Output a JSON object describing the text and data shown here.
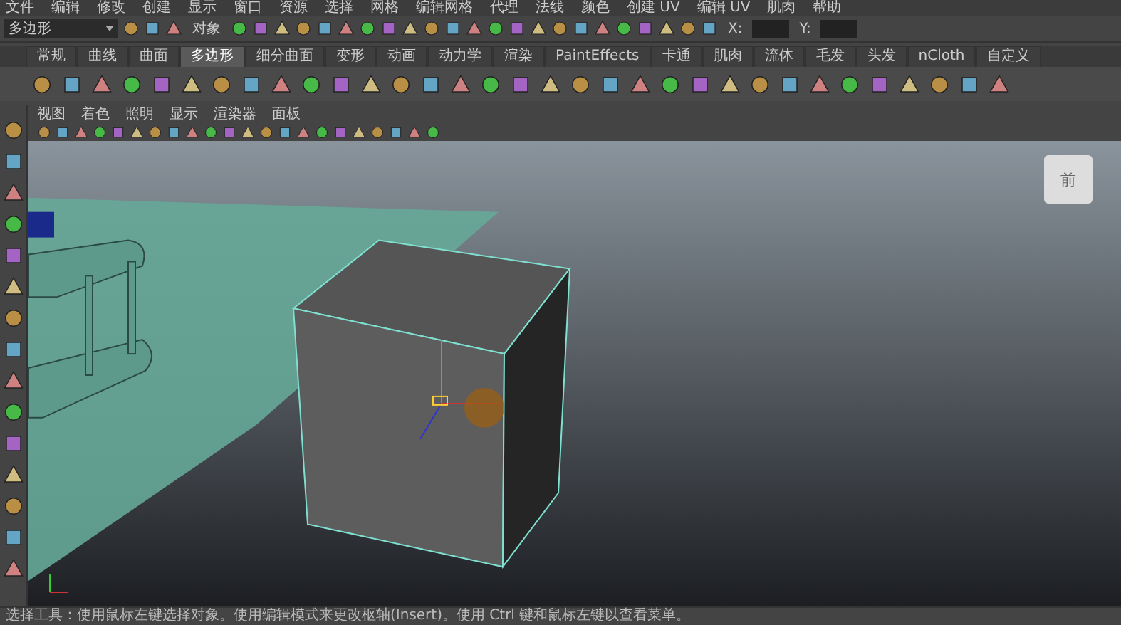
{
  "menu_bar": [
    "文件",
    "编辑",
    "修改",
    "创建",
    "显示",
    "窗口",
    "资源",
    "选择",
    "网格",
    "编辑网格",
    "代理",
    "法线",
    "颜色",
    "创建 UV",
    "编辑 UV",
    "肌肉",
    "帮助"
  ],
  "status_line": {
    "mode_menu": "多边形",
    "selection_label": "对象",
    "x_label": "X:",
    "y_label": "Y:"
  },
  "shelf": {
    "tabs": [
      {
        "label": "常规",
        "selected": false
      },
      {
        "label": "曲线",
        "selected": false
      },
      {
        "label": "曲面",
        "selected": false
      },
      {
        "label": "多边形",
        "selected": true
      },
      {
        "label": "细分曲面",
        "selected": false
      },
      {
        "label": "变形",
        "selected": false
      },
      {
        "label": "动画",
        "selected": false
      },
      {
        "label": "动力学",
        "selected": false
      },
      {
        "label": "渲染",
        "selected": false
      },
      {
        "label": "PaintEffects",
        "selected": false
      },
      {
        "label": "卡通",
        "selected": false
      },
      {
        "label": "肌肉",
        "selected": false
      },
      {
        "label": "流体",
        "selected": false
      },
      {
        "label": "毛发",
        "selected": false
      },
      {
        "label": "头发",
        "selected": false
      },
      {
        "label": "nCloth",
        "selected": false
      },
      {
        "label": "自定义",
        "selected": false
      }
    ]
  },
  "panel": {
    "menu": [
      "视图",
      "着色",
      "照明",
      "显示",
      "渲染器",
      "面板"
    ],
    "view_cube_label": "前"
  },
  "help_line": "选择工具：使用鼠标左键选择对象。使用编辑模式来更改枢轴(Insert)。使用 Ctrl 键和鼠标左键以查看菜单。"
}
